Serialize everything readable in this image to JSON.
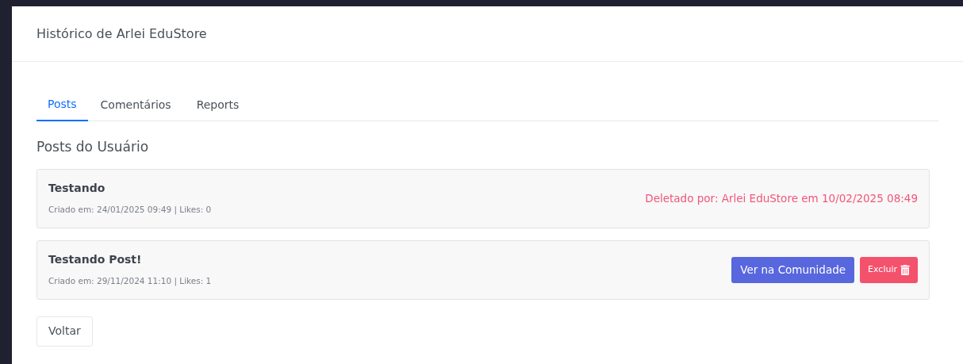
{
  "modal": {
    "title": "Histórico de Arlei EduStore"
  },
  "tabs": [
    {
      "label": "Posts",
      "selected": true
    },
    {
      "label": "Comentários",
      "selected": false
    },
    {
      "label": "Reports",
      "selected": false
    }
  ],
  "section_title": "Posts do Usuário",
  "posts": [
    {
      "kind": "deleted",
      "title": "Testando",
      "meta": "Criado em: 24/01/2025 09:49 | Likes: 0",
      "status": "Deletado por: Arlei EduStore em 10/02/2025 08:49"
    },
    {
      "kind": "active",
      "title": "Testando Post!",
      "meta": "Criado em: 29/11/2024 11:10 | Likes: 1",
      "view_button": "Ver na Comunidade",
      "delete_button": "Excluir"
    }
  ],
  "back_button": "Voltar"
}
